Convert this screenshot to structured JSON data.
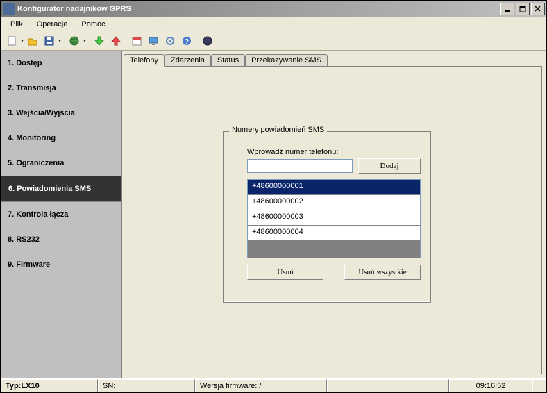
{
  "window": {
    "title": "Konfigurator nadajników GPRS"
  },
  "menu": {
    "plik": "Plik",
    "operacje": "Operacje",
    "pomoc": "Pomoc"
  },
  "sidebar": {
    "items": [
      "1. Dostęp",
      "2. Transmisja",
      "3. Wejścia/Wyjścia",
      "4. Monitoring",
      "5. Ograniczenia",
      "6. Powiadomienia SMS",
      "7. Kontrola łącza",
      "8. RS232",
      "9. Firmware"
    ],
    "selected_index": 5
  },
  "tabs": {
    "telefony": "Telefony",
    "zdarzenia": "Zdarzenia",
    "status": "Status",
    "przekazywanie": "Przekazywanie SMS",
    "active_index": 0
  },
  "group": {
    "title": "Numery powiadomień SMS",
    "input_label": "Wprowadź numer telefonu:",
    "input_value": "",
    "add_btn": "Dodaj",
    "phone_list": [
      "+48600000001",
      "+48600000002",
      "+48600000003",
      "+48600000004"
    ],
    "selected_phone_index": 0,
    "del_btn": "Usuń",
    "del_all_btn": "Usuń wszystkie"
  },
  "status": {
    "type_label": "Typ: ",
    "type_value": "LX10",
    "sn_label": "SN:",
    "sn_value": "",
    "fw_label": "Wersja firmware: /",
    "time": "09:16:52"
  }
}
